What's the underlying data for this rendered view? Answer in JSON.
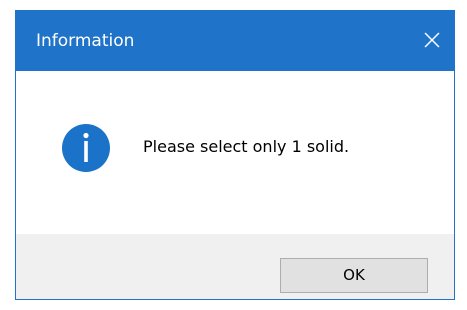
{
  "window": {
    "title": "Information"
  },
  "icons": {
    "title_close": "close-icon",
    "message_icon": "info-icon"
  },
  "message": {
    "text": "Please select only 1 solid."
  },
  "buttons": {
    "ok_label": "OK"
  },
  "colors": {
    "titlebar": "#1f73c9",
    "info_icon": "#1a73c8",
    "footer": "#f0f0f0",
    "button_bg": "#e1e1e1",
    "button_border": "#adadad"
  }
}
